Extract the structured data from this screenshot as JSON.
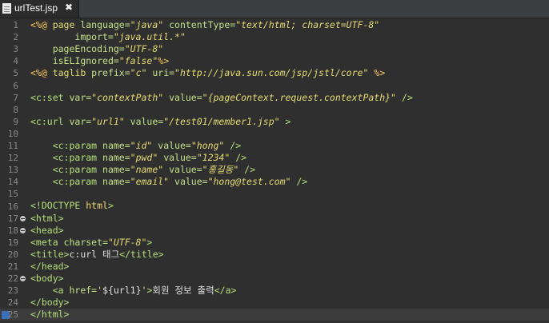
{
  "tab": {
    "title": "urlTest.jsp",
    "close_glyph": "✖"
  },
  "editor": {
    "lines": [
      {
        "n": "1",
        "fold": false,
        "seg": [
          [
            "d",
            "<%@ "
          ],
          [
            "k",
            "page "
          ],
          [
            "a",
            "language="
          ],
          [
            "s",
            "\"java\" "
          ],
          [
            "a",
            "contentType="
          ],
          [
            "s",
            "\"text/html; charset=UTF-8\""
          ]
        ]
      },
      {
        "n": "2",
        "fold": false,
        "seg": [
          [
            "t",
            "        "
          ],
          [
            "a",
            "import="
          ],
          [
            "s",
            "\"java.util.*\""
          ]
        ]
      },
      {
        "n": "3",
        "fold": false,
        "seg": [
          [
            "t",
            "    "
          ],
          [
            "a",
            "pageEncoding="
          ],
          [
            "s",
            "\"UTF-8\""
          ]
        ]
      },
      {
        "n": "4",
        "fold": false,
        "seg": [
          [
            "t",
            "    "
          ],
          [
            "a",
            "isELIgnored="
          ],
          [
            "s",
            "\"false\""
          ],
          [
            "d",
            "%>"
          ]
        ]
      },
      {
        "n": "5",
        "fold": false,
        "seg": [
          [
            "d",
            "<%@ "
          ],
          [
            "k",
            "taglib "
          ],
          [
            "a",
            "prefix="
          ],
          [
            "s",
            "\"c\" "
          ],
          [
            "a",
            "uri="
          ],
          [
            "s",
            "\"http://java.sun.com/jsp/jstl/core\" "
          ],
          [
            "d",
            "%>"
          ]
        ]
      },
      {
        "n": "6",
        "fold": false,
        "seg": []
      },
      {
        "n": "7",
        "fold": false,
        "seg": [
          [
            "g",
            "<c:set "
          ],
          [
            "a",
            "var="
          ],
          [
            "s",
            "\"contextPath\" "
          ],
          [
            "a",
            "value="
          ],
          [
            "s",
            "\"{pageContext.request.contextPath}\" "
          ],
          [
            "g",
            "/>"
          ]
        ]
      },
      {
        "n": "8",
        "fold": false,
        "seg": []
      },
      {
        "n": "9",
        "fold": false,
        "seg": [
          [
            "g",
            "<c:url "
          ],
          [
            "a",
            "var="
          ],
          [
            "s",
            "\"url1\" "
          ],
          [
            "a",
            "value="
          ],
          [
            "s",
            "\"/test01/member1.jsp\" "
          ],
          [
            "g",
            ">"
          ]
        ]
      },
      {
        "n": "10",
        "fold": false,
        "seg": []
      },
      {
        "n": "11",
        "fold": false,
        "seg": [
          [
            "t",
            "    "
          ],
          [
            "g",
            "<c:param "
          ],
          [
            "a",
            "name="
          ],
          [
            "s",
            "\"id\" "
          ],
          [
            "a",
            "value="
          ],
          [
            "s",
            "\"hong\" "
          ],
          [
            "g",
            "/>"
          ]
        ]
      },
      {
        "n": "12",
        "fold": false,
        "seg": [
          [
            "t",
            "    "
          ],
          [
            "g",
            "<c:param "
          ],
          [
            "a",
            "name="
          ],
          [
            "s",
            "\"pwd\" "
          ],
          [
            "a",
            "value="
          ],
          [
            "s",
            "\"1234\" "
          ],
          [
            "g",
            "/>"
          ]
        ]
      },
      {
        "n": "13",
        "fold": false,
        "seg": [
          [
            "t",
            "    "
          ],
          [
            "g",
            "<c:param "
          ],
          [
            "a",
            "name="
          ],
          [
            "s",
            "\"name\" "
          ],
          [
            "a",
            "value="
          ],
          [
            "s",
            "\"홍길동\" "
          ],
          [
            "g",
            "/>"
          ]
        ]
      },
      {
        "n": "14",
        "fold": false,
        "seg": [
          [
            "t",
            "    "
          ],
          [
            "g",
            "<c:param "
          ],
          [
            "a",
            "name="
          ],
          [
            "s",
            "\"email\" "
          ],
          [
            "a",
            "value="
          ],
          [
            "s",
            "\"hong@test.com\" "
          ],
          [
            "g",
            "/>"
          ]
        ]
      },
      {
        "n": "15",
        "fold": false,
        "seg": []
      },
      {
        "n": "16",
        "fold": false,
        "seg": [
          [
            "g",
            "<!DOCTYPE "
          ],
          [
            "y",
            "html"
          ],
          [
            "g",
            ">"
          ]
        ]
      },
      {
        "n": "17",
        "fold": true,
        "seg": [
          [
            "g",
            "<html>"
          ]
        ]
      },
      {
        "n": "18",
        "fold": true,
        "seg": [
          [
            "g",
            "<head>"
          ]
        ]
      },
      {
        "n": "19",
        "fold": false,
        "seg": [
          [
            "g",
            "<meta "
          ],
          [
            "a",
            "charset="
          ],
          [
            "s",
            "\"UTF-8\""
          ],
          [
            "g",
            ">"
          ]
        ]
      },
      {
        "n": "20",
        "fold": false,
        "seg": [
          [
            "g",
            "<title>"
          ],
          [
            "t",
            "c:url 태그"
          ],
          [
            "g",
            "</title>"
          ]
        ]
      },
      {
        "n": "21",
        "fold": false,
        "seg": [
          [
            "g",
            "</head>"
          ]
        ]
      },
      {
        "n": "22",
        "fold": true,
        "seg": [
          [
            "g",
            "<body>"
          ]
        ]
      },
      {
        "n": "23",
        "fold": false,
        "seg": [
          [
            "t",
            "    "
          ],
          [
            "g",
            "<a "
          ],
          [
            "a",
            "href="
          ],
          [
            "y",
            "'"
          ],
          [
            "t",
            "${url1}"
          ],
          [
            "y",
            "'"
          ],
          [
            "g",
            ">"
          ],
          [
            "t",
            "회원 정보 출력"
          ],
          [
            "g",
            "</a>"
          ]
        ]
      },
      {
        "n": "24",
        "fold": false,
        "seg": [
          [
            "g",
            "</body>"
          ]
        ]
      },
      {
        "n": "25",
        "fold": false,
        "current": true,
        "seg": [
          [
            "g",
            "</html>"
          ]
        ]
      }
    ]
  }
}
